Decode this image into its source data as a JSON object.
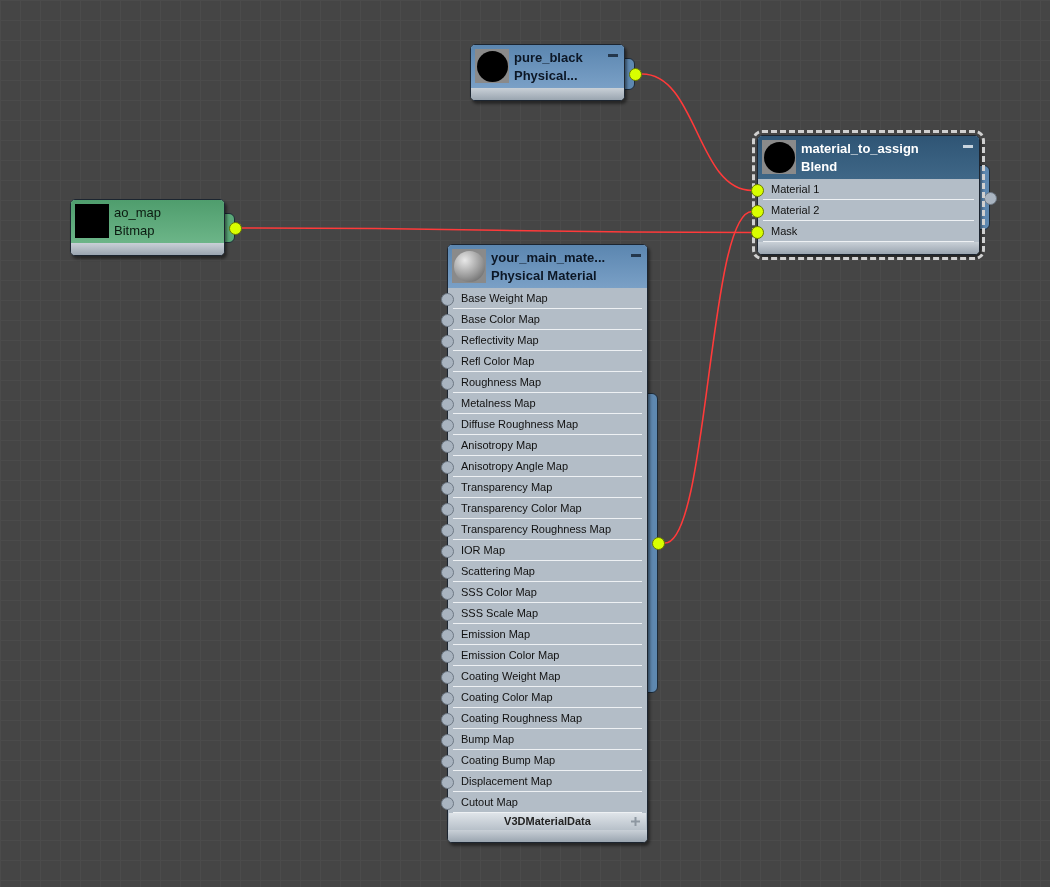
{
  "nodes": [
    {
      "name": "pure_black",
      "type": "Physical...",
      "kind": "material",
      "swatch": {
        "kind": "black_sphere"
      },
      "selected": false,
      "output_connected": true
    },
    {
      "name": "ao_map",
      "type": "Bitmap",
      "kind": "map",
      "swatch": {
        "kind": "black_square"
      },
      "selected": false,
      "output_connected": true
    },
    {
      "name": "material_to_assign",
      "type": "Blend",
      "kind": "material",
      "swatch": {
        "kind": "black_sphere"
      },
      "selected": true,
      "output_connected": false,
      "inputs": [
        {
          "label": "Material 1",
          "connected": true
        },
        {
          "label": "Material 2",
          "connected": true
        },
        {
          "label": "Mask",
          "connected": true
        }
      ]
    },
    {
      "name": "your_main_mate...",
      "type": "Physical Material",
      "kind": "material",
      "swatch": {
        "kind": "grey_sphere"
      },
      "selected": false,
      "output_connected": true,
      "footer": "V3DMaterialData",
      "inputs": [
        {
          "label": "Base Weight Map",
          "connected": false
        },
        {
          "label": "Base Color Map",
          "connected": false
        },
        {
          "label": "Reflectivity Map",
          "connected": false
        },
        {
          "label": "Refl Color Map",
          "connected": false
        },
        {
          "label": "Roughness Map",
          "connected": false
        },
        {
          "label": "Metalness Map",
          "connected": false
        },
        {
          "label": "Diffuse Roughness Map",
          "connected": false
        },
        {
          "label": "Anisotropy Map",
          "connected": false
        },
        {
          "label": "Anisotropy Angle Map",
          "connected": false
        },
        {
          "label": "Transparency Map",
          "connected": false
        },
        {
          "label": "Transparency Color Map",
          "connected": false
        },
        {
          "label": "Transparency Roughness Map",
          "connected": false
        },
        {
          "label": "IOR Map",
          "connected": false
        },
        {
          "label": "Scattering Map",
          "connected": false
        },
        {
          "label": "SSS Color Map",
          "connected": false
        },
        {
          "label": "SSS Scale Map",
          "connected": false
        },
        {
          "label": "Emission Map",
          "connected": false
        },
        {
          "label": "Emission Color Map",
          "connected": false
        },
        {
          "label": "Coating Weight Map",
          "connected": false
        },
        {
          "label": "Coating Color Map",
          "connected": false
        },
        {
          "label": "Coating Roughness Map",
          "connected": false
        },
        {
          "label": "Bump Map",
          "connected": false
        },
        {
          "label": "Coating Bump Map",
          "connected": false
        },
        {
          "label": "Displacement Map",
          "connected": false
        },
        {
          "label": "Cutout Map",
          "connected": false
        }
      ]
    }
  ]
}
